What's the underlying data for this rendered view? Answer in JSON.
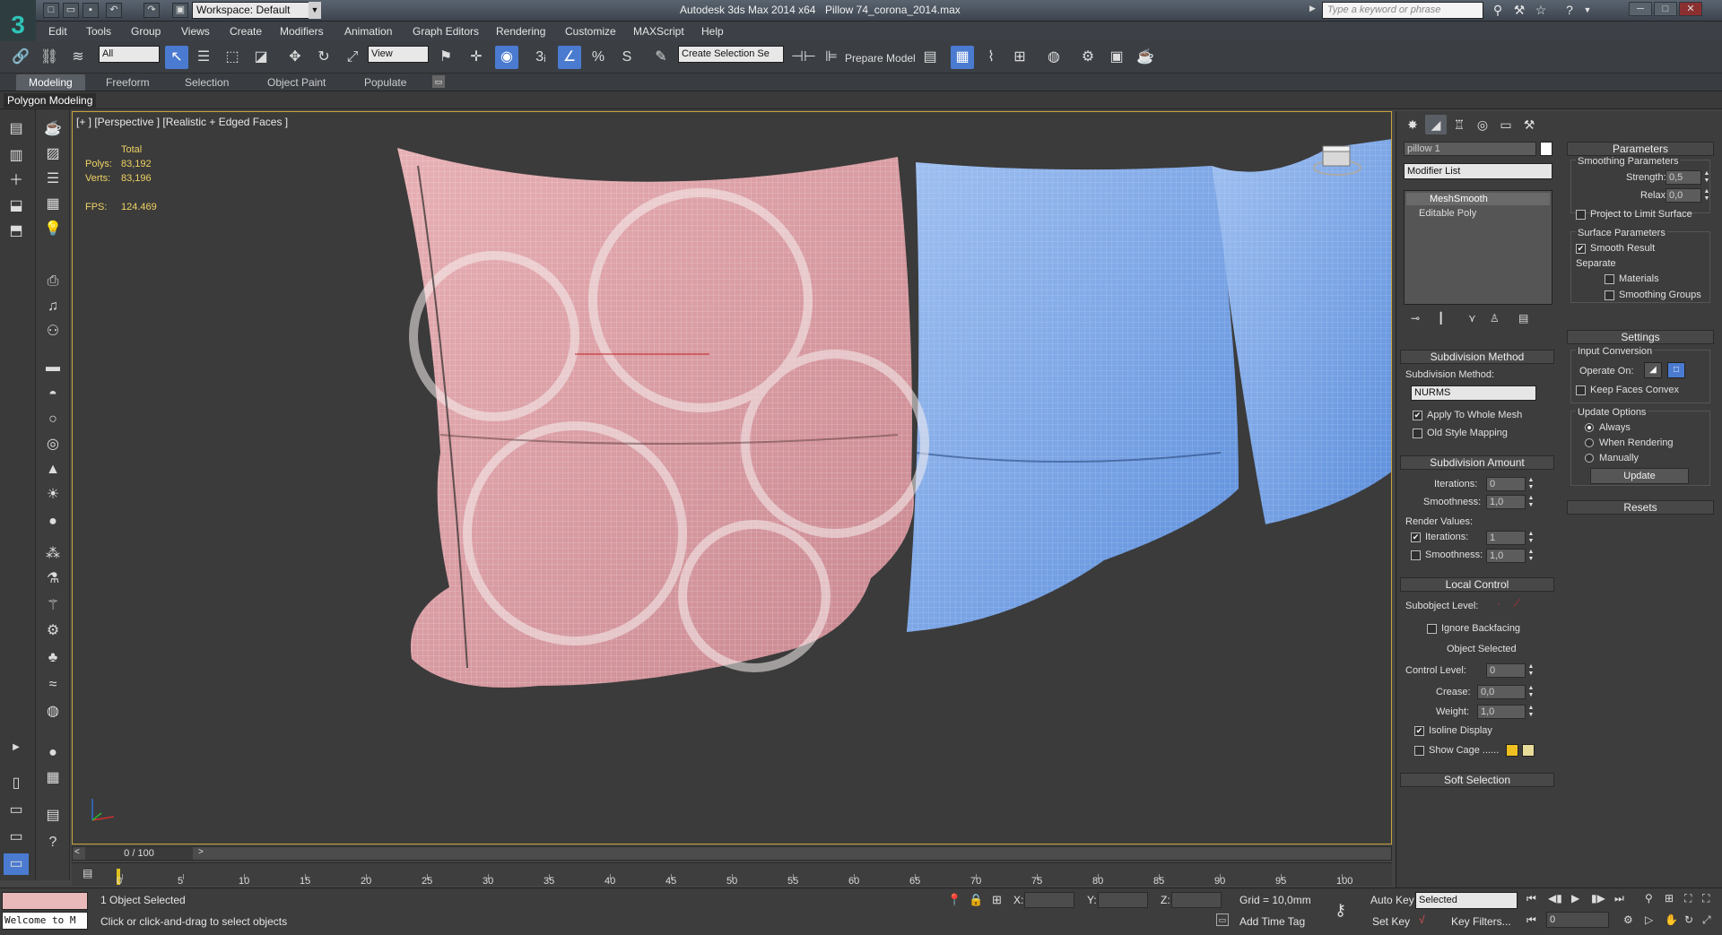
{
  "titlebar": {
    "workspace_label": "Workspace: Default",
    "app_title": "Autodesk 3ds Max  2014 x64",
    "file_title": "Pillow 74_corona_2014.max",
    "search_placeholder": "Type a keyword or phrase"
  },
  "menu": [
    "Edit",
    "Tools",
    "Group",
    "Views",
    "Create",
    "Modifiers",
    "Animation",
    "Graph Editors",
    "Rendering",
    "Customize",
    "MAXScript",
    "Help"
  ],
  "toolbar": {
    "selection_filter": "All",
    "ref_coord": "View",
    "named_selection": "Create Selection Se",
    "prepare_model": "Prepare Model",
    "angle_snap": "3",
    "percent_snap": "%",
    "spinner_snap": "S"
  },
  "ribbon": {
    "tabs": [
      "Modeling",
      "Freeform",
      "Selection",
      "Object Paint",
      "Populate"
    ],
    "polygon_modeling": "Polygon Modeling"
  },
  "viewport": {
    "label": "[+ ] [Perspective ] [Realistic + Edged Faces ]",
    "stats_total": "Total",
    "polys_label": "Polys:",
    "polys_value": "83,192",
    "verts_label": "Verts:",
    "verts_value": "83,196",
    "fps_label": "FPS:",
    "fps_value": "124.469"
  },
  "timeline": {
    "frame_indicator": "0 / 100",
    "ticks": [
      "0",
      "5",
      "10",
      "15",
      "20",
      "25",
      "30",
      "35",
      "40",
      "45",
      "50",
      "55",
      "60",
      "65",
      "70",
      "75",
      "80",
      "85",
      "90",
      "95",
      "100"
    ]
  },
  "status": {
    "maxscript_text": "Welcome to M",
    "selection_info": "1 Object Selected",
    "prompt": "Click or click-and-drag to select objects",
    "x_label": "X:",
    "y_label": "Y:",
    "z_label": "Z:",
    "grid": "Grid = 10,0mm",
    "add_time_tag": "Add Time Tag",
    "auto_key": "Auto Key",
    "set_key": "Set Key",
    "selected_dropdown": "Selected",
    "key_filters": "Key Filters...",
    "frame_value": "0"
  },
  "command_panel": {
    "object_name": "pillow 1",
    "modifier_list": "Modifier List",
    "stack": [
      "MeshSmooth",
      "Editable Poly"
    ],
    "subdivision_method": {
      "header": "Subdivision Method",
      "label": "Subdivision Method:",
      "value": "NURMS",
      "apply_whole_mesh": "Apply To Whole Mesh",
      "old_style": "Old Style Mapping"
    },
    "subdivision_amount": {
      "header": "Subdivision Amount",
      "iterations_label": "Iterations:",
      "iterations_value": "0",
      "smoothness_label": "Smoothness:",
      "smoothness_value": "1,0",
      "render_values": "Render Values:",
      "render_iterations_label": "Iterations:",
      "render_iterations_value": "1",
      "render_smoothness_label": "Smoothness:",
      "render_smoothness_value": "1,0"
    },
    "local_control": {
      "header": "Local Control",
      "subobject_level": "Subobject Level:",
      "ignore_backfacing": "Ignore Backfacing",
      "object_selected": "Object Selected",
      "control_level_label": "Control Level:",
      "control_level_value": "0",
      "crease_label": "Crease:",
      "crease_value": "0,0",
      "weight_label": "Weight:",
      "weight_value": "1,0",
      "isoline_display": "Isoline Display",
      "show_cage": "Show Cage ......"
    },
    "soft_selection": "Soft Selection",
    "parameters": {
      "header": "Parameters",
      "smoothing_params": "Smoothing Parameters",
      "strength_label": "Strength:",
      "strength_value": "0,5",
      "relax_label": "Relax:",
      "relax_value": "0,0",
      "project_limit": "Project to Limit Surface",
      "surface_params": "Surface Parameters",
      "smooth_result": "Smooth Result",
      "separate": "Separate",
      "materials": "Materials",
      "smoothing_groups": "Smoothing Groups"
    },
    "settings": {
      "header": "Settings",
      "input_conversion": "Input Conversion",
      "operate_on": "Operate On:",
      "keep_faces_convex": "Keep Faces Convex",
      "update_options": "Update Options",
      "always": "Always",
      "when_rendering": "When Rendering",
      "manually": "Manually",
      "update": "Update"
    },
    "resets": "Resets"
  },
  "colors": {
    "accent": "#4a7bd0",
    "viewport_border": "#c9a43a",
    "stats": "#f0d264",
    "pillow_pink": "#d89aa0",
    "pillow_blue": "#7aa6e6"
  }
}
